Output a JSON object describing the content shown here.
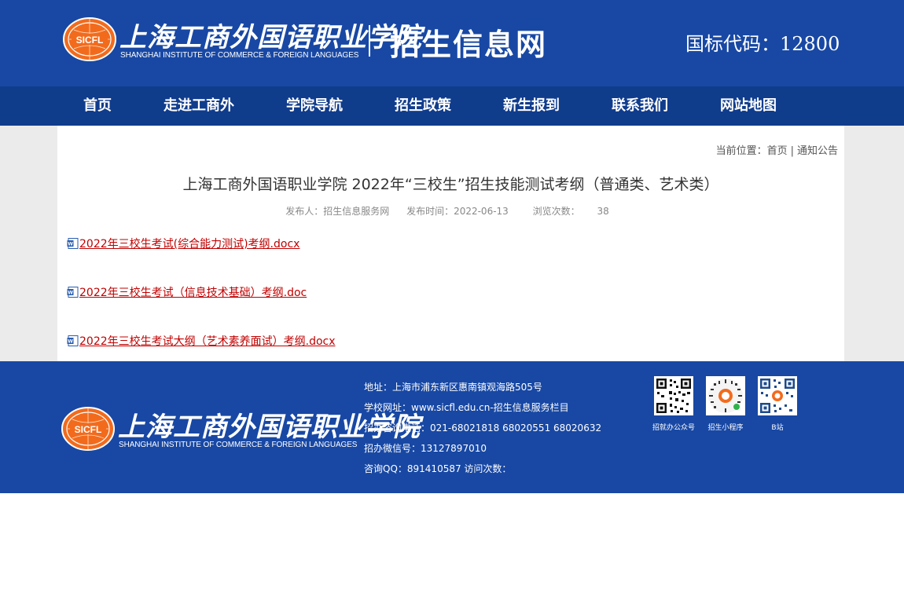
{
  "header": {
    "logo_cn": "上海工商外国语职业学院",
    "logo_en": "SHANGHAI INSTITUTE OF COMMERCE & FOREIGN LANGUAGES",
    "emblem_text": "SICFL",
    "site_title": "招生信息网",
    "national_code": "国标代码：12800"
  },
  "nav": {
    "items": [
      {
        "label": "首页"
      },
      {
        "label": "走进工商外"
      },
      {
        "label": "学院导航"
      },
      {
        "label": "招生政策"
      },
      {
        "label": "新生报到"
      },
      {
        "label": "联系我们"
      },
      {
        "label": "网站地图"
      }
    ]
  },
  "breadcrumb": {
    "prefix": "当前位置：",
    "home": "首页",
    "separator": "|",
    "current": "通知公告"
  },
  "article": {
    "title": "上海工商外国语职业学院 2022年“三校生”招生技能测试考纲（普通类、艺术类）",
    "publisher": "发布人：招生信息服务网",
    "publish_time": "发布时间：2022-06-13",
    "views_label": "浏览次数：",
    "views": "38",
    "attachments": [
      {
        "name": "2022年三校生考试(综合能力测试)考纲.docx",
        "icon": "word-doc-icon"
      },
      {
        "name": "2022年三校生考试（信息技术基础）考纲.doc",
        "icon": "word-doc-icon"
      },
      {
        "name": "2022年三校生考试大纲（艺术素养面试）考纲.docx",
        "icon": "word-doc-icon"
      }
    ]
  },
  "footer": {
    "contact": [
      "地址：上海市浦东新区惠南镇观海路505号",
      "学校网址：www.sicfl.edu.cn-招生信息服务栏目",
      "招办咨询电话：021-68021818 68020551 68020632",
      "招办微信号：13127897010",
      "咨询QQ：891410587 访问次数："
    ],
    "qr_codes": [
      {
        "label": "招就办公众号",
        "icon": "qr-code-icon"
      },
      {
        "label": "招生小程序",
        "icon": "mini-program-qr-icon"
      },
      {
        "label": "B站",
        "icon": "bilibili-qr-icon"
      }
    ]
  },
  "colors": {
    "header_blue": "#1848a4",
    "nav_blue": "#103c8c",
    "link_red": "#c00000",
    "emblem_orange": "#f26b1d"
  }
}
